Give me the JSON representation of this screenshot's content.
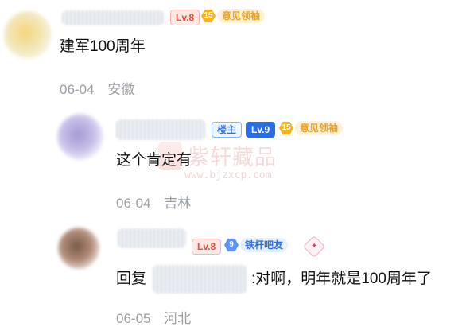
{
  "comments": [
    {
      "level": "Lv.8",
      "title_number": "15",
      "title_text": "意见领袖",
      "content": "建军100周年",
      "date": "06-04",
      "location": "安徽"
    },
    {
      "owner_label": "楼主",
      "level": "Lv.9",
      "title_number": "15",
      "title_text": "意见领袖",
      "content": "这个肯定有",
      "date": "06-04",
      "location": "吉林"
    },
    {
      "level": "Lv.8",
      "title_number": "9",
      "title_text": "铁杆吧友",
      "reply_prefix": "回复",
      "content_after": ":对啊，明年就是100周年了",
      "date": "06-05",
      "location": "河北"
    }
  ],
  "watermark": {
    "main": "紫轩藏品",
    "url": "www.bjzxcp.com"
  },
  "colors": {
    "meta": "#9aa0a6",
    "level_red": "#e74c3c",
    "level_blue": "#2b6de5",
    "title_orange": "#f0a321",
    "title_blue": "#2f6fe6"
  }
}
